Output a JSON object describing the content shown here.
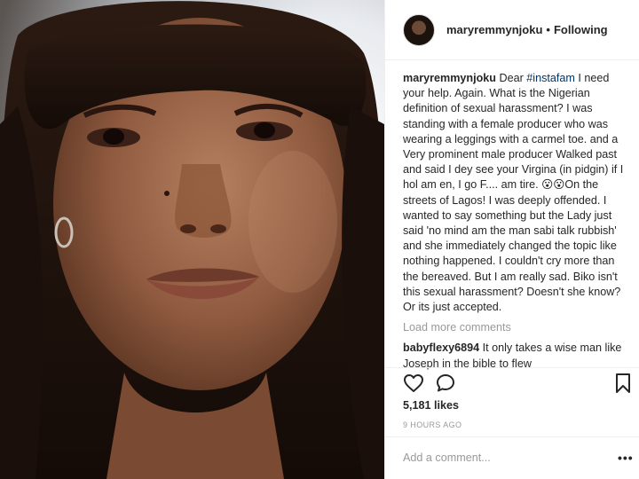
{
  "post": {
    "author": "maryremmynjoku",
    "follow_status": "Following",
    "separator": "•"
  },
  "caption": {
    "username": "maryremmynjoku",
    "text_before": " Dear ",
    "hashtag": "#instafam",
    "text_after": " I need your help. Again. What is the Nigerian definition of sexual harassment? I was standing with a female producer who was wearing a leggings with a carmel toe. and a Very prominent male producer Walked past and said I dey see your Virgina (in pidgin) if I hol am en, I go F.... am tire. 😮😮On the streets of Lagos! I was deeply offended. I wanted to say something but the Lady just said 'no mind am the man sabi talk rubbish' and she immediately changed the topic like nothing happened. I couldn't cry more than the bereaved. But I am really sad. Biko isn't this sexual harassment? Doesn't she know? Or its just accepted."
  },
  "load_more": "Load more comments",
  "comment": {
    "username": "babyflexy6894",
    "text": " It only takes a wise man like Joseph in the bible to flew"
  },
  "likes": "5,181 likes",
  "timestamp": "9 HOURS AGO",
  "add_comment_placeholder": "Add a comment...",
  "more_label": "•••",
  "icons": [
    "heart-icon",
    "comment-icon",
    "bookmark-icon"
  ]
}
